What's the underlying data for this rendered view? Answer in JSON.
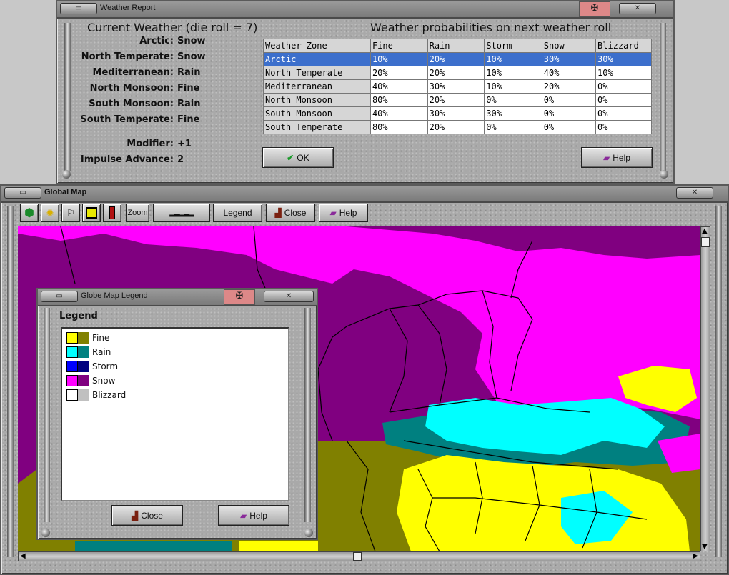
{
  "weather_report": {
    "window_title": "Weather Report",
    "flag_symbol": "✠",
    "current_title": "Current Weather (die roll = 7)",
    "prob_title": "Weather probabilities on next weather roll",
    "current": [
      {
        "zone": "Arctic:",
        "weather": "Snow"
      },
      {
        "zone": "North Temperate:",
        "weather": "Snow"
      },
      {
        "zone": "Mediterranean:",
        "weather": "Rain"
      },
      {
        "zone": "North Monsoon:",
        "weather": "Fine"
      },
      {
        "zone": "South Monsoon:",
        "weather": "Rain"
      },
      {
        "zone": "South Temperate:",
        "weather": "Fine"
      }
    ],
    "modifier_label": "Modifier:",
    "modifier_value": "+1",
    "impulse_label": "Impulse Advance:",
    "impulse_value": "2",
    "table": {
      "headers": [
        "Weather Zone",
        "Fine",
        "Rain",
        "Storm",
        "Snow",
        "Blizzard"
      ],
      "rows": [
        [
          "Arctic",
          "10%",
          "20%",
          "10%",
          "30%",
          "30%"
        ],
        [
          "North Temperate",
          "20%",
          "20%",
          "10%",
          "40%",
          "10%"
        ],
        [
          "Mediterranean",
          "40%",
          "30%",
          "10%",
          "20%",
          "0%"
        ],
        [
          "North Monsoon",
          "80%",
          "20%",
          "0%",
          "0%",
          "0%"
        ],
        [
          "South Monsoon",
          "40%",
          "30%",
          "30%",
          "0%",
          "0%"
        ],
        [
          "South Temperate",
          "80%",
          "20%",
          "0%",
          "0%",
          "0%"
        ]
      ],
      "selected_row": "Arctic"
    },
    "ok_label": "OK",
    "help_label": "Help"
  },
  "global_map": {
    "window_title": "Global Map",
    "toolbar": {
      "zoom_label": "Zoom",
      "legend_label": "Legend",
      "close_label": "Close",
      "help_label": "Help"
    }
  },
  "legend_window": {
    "window_title": "Globe Map Legend",
    "flag_symbol": "✠",
    "heading": "Legend",
    "items": [
      {
        "label": "Fine",
        "color_light": "#ffff00",
        "color_dark": "#808000"
      },
      {
        "label": "Rain",
        "color_light": "#00ffff",
        "color_dark": "#008080"
      },
      {
        "label": "Storm",
        "color_light": "#0000ff",
        "color_dark": "#000080"
      },
      {
        "label": "Snow",
        "color_light": "#ff00ff",
        "color_dark": "#800080"
      },
      {
        "label": "Blizzard",
        "color_light": "#ffffff",
        "color_dark": "#c0c0c0"
      }
    ],
    "close_label": "Close",
    "help_label": "Help"
  },
  "colors": {
    "selection": "#3c6fcc",
    "snow_light": "#ff00ff",
    "snow_dark": "#800080",
    "fine_light": "#ffff00",
    "fine_dark": "#808000",
    "rain_light": "#00ffff",
    "rain_dark": "#008080"
  }
}
